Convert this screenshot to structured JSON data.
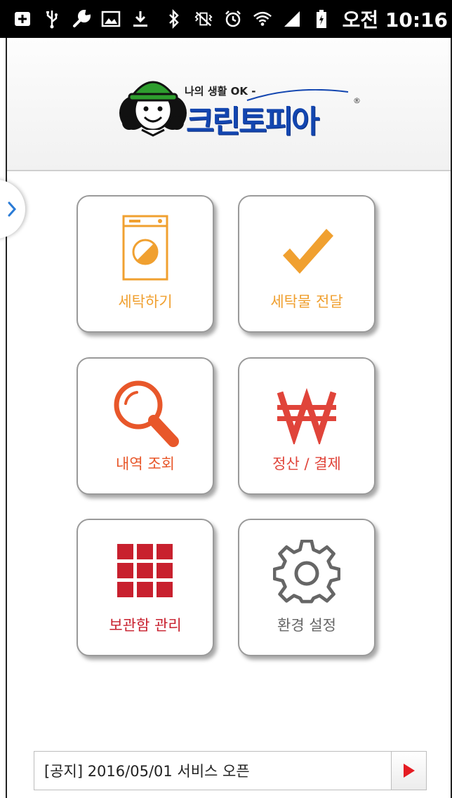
{
  "status_bar": {
    "time": "오전 10:16",
    "left_icons": [
      "add-box-icon",
      "usb-icon",
      "wrench-icon",
      "image-icon",
      "download-icon"
    ],
    "right_icons": [
      "bluetooth-icon",
      "vibrate-icon",
      "alarm-icon",
      "wifi-icon",
      "signal-icon",
      "battery-icon"
    ]
  },
  "header": {
    "logo_tagline": "나의 생활 OK -",
    "logo_name": "크린토피아",
    "brand_color": "#1346b0",
    "brand_accent": "#2e9e2e"
  },
  "menu": [
    {
      "id": "laundry",
      "label": "세탁하기",
      "icon": "washing-machine-icon",
      "color": "#f0a030"
    },
    {
      "id": "deliver",
      "label": "세탁물 전달",
      "icon": "checkmark-icon",
      "color": "#f0a030"
    },
    {
      "id": "history",
      "label": "내역 조회",
      "icon": "magnifier-icon",
      "color": "#e8572a"
    },
    {
      "id": "payment",
      "label": "정산 / 결제",
      "icon": "won-icon",
      "color": "#e0443a"
    },
    {
      "id": "locker",
      "label": "보관함 관리",
      "icon": "locker-grid-icon",
      "color": "#c8202e"
    },
    {
      "id": "settings",
      "label": "환경 설정",
      "icon": "gear-icon",
      "color": "#666666"
    }
  ],
  "notice": {
    "text": "[공지] 2016/05/01 서비스 오픈",
    "button_icon": "play-arrow-icon",
    "button_color": "#e51c23"
  }
}
